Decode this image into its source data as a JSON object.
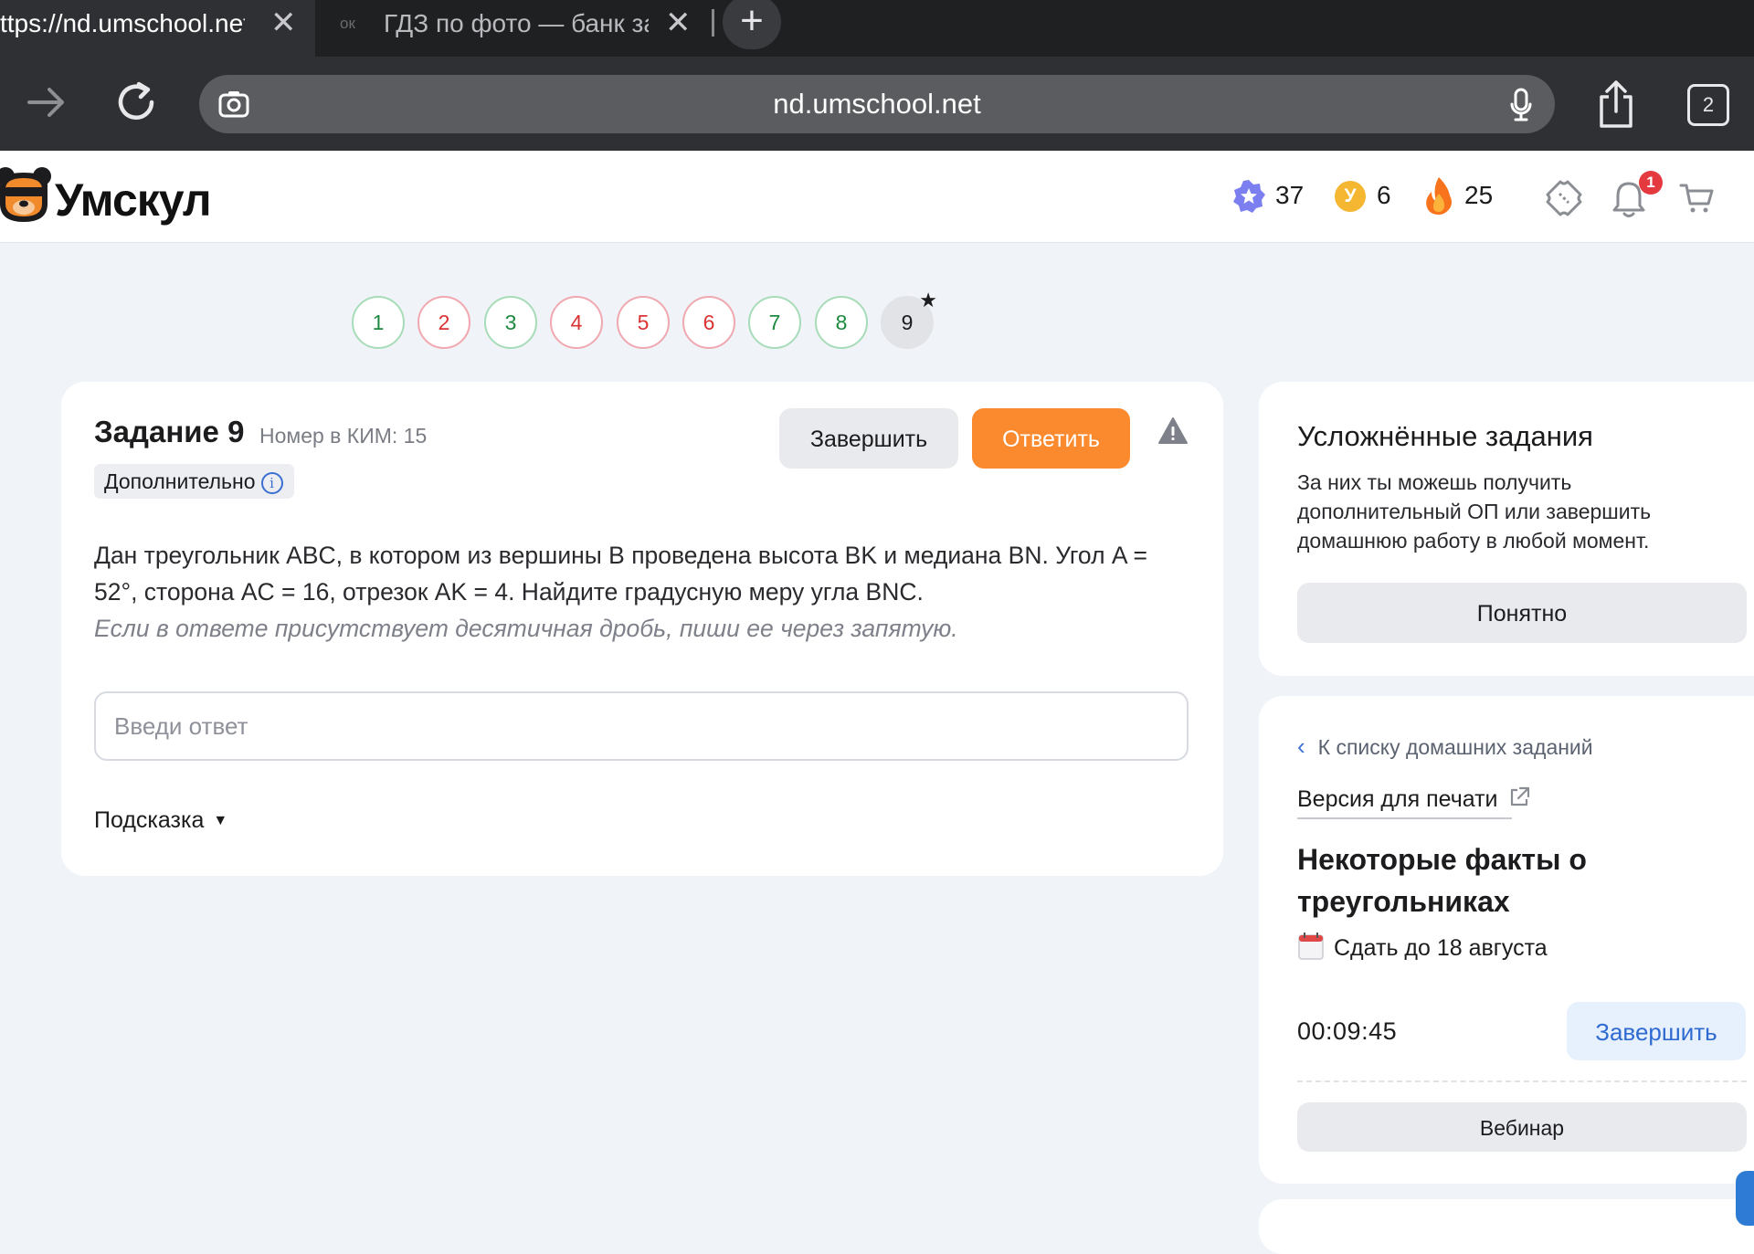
{
  "browser": {
    "tabs": [
      {
        "title": "ttps://nd.umschool.net/",
        "close_glyph": "✕"
      },
      {
        "favicon": "ок",
        "title": "ГДЗ по фото — банк зад",
        "close_glyph": "✕"
      }
    ],
    "new_tab_glyph": "+",
    "url": "nd.umschool.net",
    "tabs_count": "2",
    "icons": [
      "forward-arrow-icon",
      "reload-icon",
      "camera-search-icon",
      "microphone-icon",
      "share-icon",
      "tabs-icon"
    ]
  },
  "header": {
    "logo_text": "Умскул",
    "stats": [
      {
        "icon": "star-badge-icon",
        "value": "37"
      },
      {
        "icon": "coin-icon",
        "coin_letter": "У",
        "value": "6"
      },
      {
        "icon": "fire-icon",
        "value": "25"
      }
    ],
    "notifications_badge": "1",
    "icons": [
      "ticket-icon",
      "bell-icon",
      "cart-icon"
    ]
  },
  "steps": [
    {
      "label": "1",
      "status": "correct"
    },
    {
      "label": "2",
      "status": "wrong"
    },
    {
      "label": "3",
      "status": "correct"
    },
    {
      "label": "4",
      "status": "wrong"
    },
    {
      "label": "5",
      "status": "wrong"
    },
    {
      "label": "6",
      "status": "wrong"
    },
    {
      "label": "7",
      "status": "correct"
    },
    {
      "label": "8",
      "status": "correct"
    },
    {
      "label": "9",
      "status": "current",
      "star": "★"
    }
  ],
  "task": {
    "title": "Задание 9",
    "kim": "Номер в КИМ: 15",
    "badge": "Дополнительно",
    "info_glyph": "i",
    "text": "Дан треугольник ABC, в котором из вершины B проведена высота BK и медиана BN. Угол A = 52°, сторона AC = 16, отрезок AK = 4. Найдите градусную меру угла BNC.",
    "hint_text": "Если в ответе присутствует десятичная дробь, пиши ее через запятую.",
    "answer_placeholder": "Введи ответ",
    "answer_value": "",
    "hint_toggle": "Подсказка",
    "finish_label": "Завершить",
    "answer_label": "Ответить"
  },
  "side_info": {
    "title": "Усложнённые задания",
    "text": "За них ты можешь получить дополнительный ОП или завершить домашнюю работу в любой момент.",
    "ok_label": "Понятно"
  },
  "homework": {
    "back_label": "К списку домашних заданий",
    "print_label": "Версия для печати",
    "title": "Некоторые факты о треугольниках",
    "due": "Сдать до 18 августа",
    "timer": "00:09:45",
    "finish_label": "Завершить",
    "webinar_label": "Вебинар"
  },
  "colors": {
    "accent_orange": "#fb8a2e",
    "correct_green": "#1e8a3f",
    "wrong_red": "#d93333",
    "link_blue": "#2f6ad1"
  }
}
